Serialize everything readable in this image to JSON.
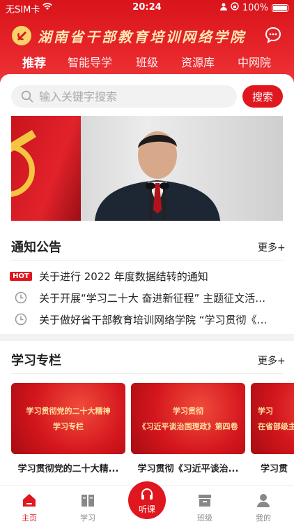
{
  "status": {
    "carrier": "无SIM卡",
    "time": "20:24",
    "battery": "100%"
  },
  "header": {
    "title": "湖南省干部教育培训网络学院"
  },
  "tabs": [
    {
      "label": "推荐"
    },
    {
      "label": "智能导学"
    },
    {
      "label": "班级"
    },
    {
      "label": "资源库"
    },
    {
      "label": "中网院"
    }
  ],
  "search": {
    "placeholder": "输入关键字搜索",
    "button": "搜索"
  },
  "notices": {
    "title": "通知公告",
    "more": "更多+",
    "items": [
      {
        "badge": "HOT",
        "text": "关于进行 2022 年度数据结转的通知"
      },
      {
        "text": "关于开展“学习二十大  奋进新征程” 主题征文活动的通知"
      },
      {
        "text": "关于做好省干部教育培训网络学院 “学习贯彻《习近平谈治国理政》第四卷”"
      }
    ]
  },
  "study": {
    "title": "学习专栏",
    "more": "更多+",
    "cards": [
      {
        "img_line1": "学习贯彻党的二十大精神",
        "img_line2": "学习专栏",
        "caption": "学习贯彻党的二十大精..."
      },
      {
        "img_line1": "学习贯彻",
        "img_line2": "《习近平谈治国理政》第四卷",
        "caption": "学习贯彻《习近平谈治..."
      },
      {
        "img_line1": "学习",
        "img_line2": "在省部级主要",
        "caption": "学习贯"
      }
    ]
  },
  "nav": {
    "home": "主页",
    "study": "学习",
    "listen": "听课",
    "class": "班级",
    "mine": "我的"
  },
  "colors": {
    "brand_red": "#e0171e"
  }
}
